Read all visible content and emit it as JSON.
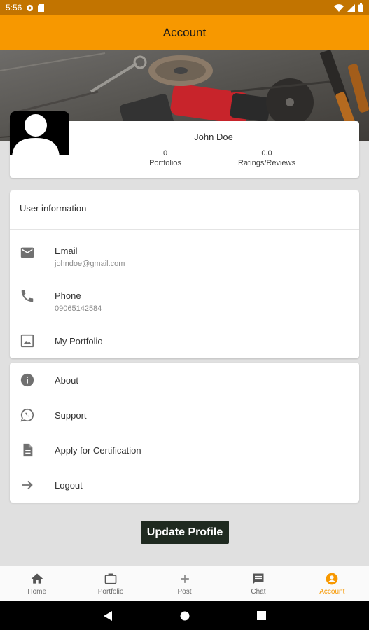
{
  "status_bar": {
    "time": "5:56"
  },
  "app_bar": {
    "title": "Account"
  },
  "profile": {
    "name": "John Doe",
    "portfolios_count": "0",
    "portfolios_label": "Portfolios",
    "rating_value": "0.0",
    "rating_label": "Ratings/Reviews"
  },
  "user_info": {
    "header": "User information",
    "email_label": "Email",
    "email_value": "johndoe@gmail.com",
    "phone_label": "Phone",
    "phone_value": "09065142584",
    "portfolio_label": "My Portfolio"
  },
  "menu": {
    "about": "About",
    "support": "Support",
    "certification": "Apply for Certification",
    "logout": "Logout"
  },
  "update_button": "Update Profile",
  "bottom_nav": [
    {
      "label": "Home",
      "icon": "home-icon"
    },
    {
      "label": "Portfolio",
      "icon": "briefcase-icon"
    },
    {
      "label": "Post",
      "icon": "plus-icon"
    },
    {
      "label": "Chat",
      "icon": "chat-icon"
    },
    {
      "label": "Account",
      "icon": "account-circle-icon"
    }
  ],
  "colors": {
    "accent": "#f79800",
    "status_bar": "#c27400",
    "button": "#1f2a20"
  }
}
